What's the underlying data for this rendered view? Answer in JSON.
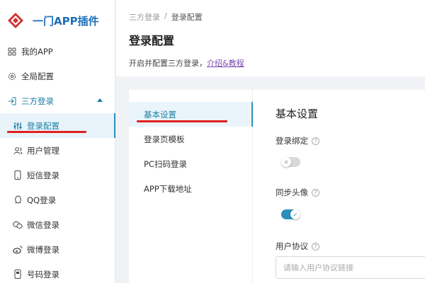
{
  "app": {
    "title": "一门APP插件"
  },
  "sidebar": {
    "items": [
      {
        "label": "我的APP",
        "icon": "grid-icon"
      },
      {
        "label": "全局配置",
        "icon": "gear-icon"
      },
      {
        "label": "三方登录",
        "icon": "login-icon"
      },
      {
        "label": "登录配置",
        "icon": "sliders-icon"
      },
      {
        "label": "用户管理",
        "icon": "users-icon"
      },
      {
        "label": "短信登录",
        "icon": "phone-icon"
      },
      {
        "label": "QQ登录",
        "icon": "qq-icon"
      },
      {
        "label": "微信登录",
        "icon": "wechat-icon"
      },
      {
        "label": "微博登录",
        "icon": "weibo-icon"
      },
      {
        "label": "号码登录",
        "icon": "mobile-icon"
      }
    ]
  },
  "header": {
    "breadcrumb": [
      "三方登录",
      "/",
      "登录配置"
    ],
    "title": "登录配置",
    "desc": "开启并配置三方登录，",
    "link": "介绍&教程"
  },
  "subnav": {
    "items": [
      "基本设置",
      "登录页模板",
      "PC扫码登录",
      "APP下载地址"
    ]
  },
  "settings": {
    "title": "基本设置",
    "login_binding": {
      "label": "登录绑定",
      "enabled": false
    },
    "sync_avatar": {
      "label": "同步头像",
      "enabled": true
    },
    "user_agreement": {
      "label": "用户协议",
      "placeholder": "请输入用户协议链接",
      "value": ""
    }
  },
  "colors": {
    "accent": "#2a8fbd",
    "brand": "#1e6fb8",
    "annotation": "#e02020"
  }
}
